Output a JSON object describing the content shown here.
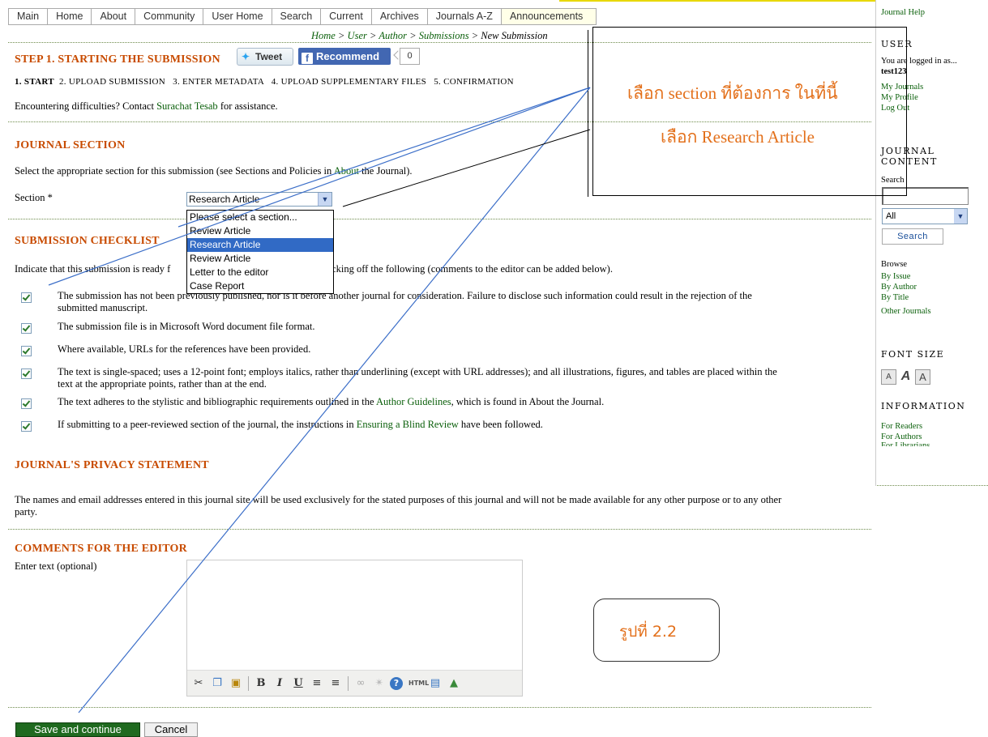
{
  "nav": {
    "items": [
      "Main",
      "Home",
      "About",
      "Community",
      "User Home",
      "Search",
      "Current",
      "Archives",
      "Journals A-Z",
      "Announcements"
    ]
  },
  "breadcrumb": {
    "parts": [
      "Home",
      "User",
      "Author",
      "Submissions",
      "New Submission"
    ],
    "separator": ">"
  },
  "step": {
    "title": "STEP 1. STARTING THE SUBMISSION",
    "tweet_label": "Tweet",
    "recommend_label": "Recommend",
    "recommend_count": "0",
    "steps_current": "1. START",
    "steps_rest": "2. UPLOAD SUBMISSION   3. ENTER METADATA   4. UPLOAD SUPPLEMENTARY FILES   5. CONFIRMATION",
    "difficulty_prefix": "Encountering difficulties? Contact",
    "contact_name": "Surachat Tesab",
    "difficulty_suffix": "for assistance."
  },
  "journal_section": {
    "heading": "JOURNAL SECTION",
    "intro_prefix": "Select the appropriate section for this submission (see Sections and Policies in",
    "intro_link": "About",
    "intro_suffix": "the Journal).",
    "field_label": "Section *",
    "selected": "Research Article",
    "options": [
      "Please select a section...",
      "Review Article",
      "Research Article",
      "Review Article",
      "Letter to the editor",
      "Case Report"
    ]
  },
  "checklist": {
    "heading": "SUBMISSION CHECKLIST",
    "intro_prefix": "Indicate that this submission is ready f",
    "intro_suffix": "y checking off the following (comments to the editor can be added below).",
    "items": [
      {
        "line1": "The submission has not been previously published, nor is it before another journal for consideration. Failure to disclose such information could result in the rejection of the",
        "line2": "submitted manuscript."
      },
      {
        "line1": "The submission file is in Microsoft Word document file format.",
        "line2": ""
      },
      {
        "line1": "Where available, URLs for the references have been provided.",
        "line2": ""
      },
      {
        "line1": "The text is single-spaced; uses a 12-point font; employs italics, rather than underlining (except with URL addresses); and all illustrations, figures, and tables are placed within the",
        "line2": "text at the appropriate points, rather than at the end."
      },
      {
        "line1_prefix": "The text adheres to the stylistic and bibliographic requirements outlined in the",
        "link": "Author Guidelines",
        "line1_suffix": ", which is found in About the Journal."
      },
      {
        "line1_prefix": "If submitting to a peer-reviewed section of the journal, the instructions in",
        "link": "Ensuring a Blind Review",
        "line1_suffix": "have been followed."
      }
    ]
  },
  "privacy": {
    "heading": "JOURNAL'S PRIVACY STATEMENT",
    "line1": "The names and email addresses entered in this journal site will be used exclusively for the stated purposes of this journal and will not be made available for any other purpose or to any other",
    "line2": "party."
  },
  "comments": {
    "heading": "COMMENTS FOR THE EDITOR",
    "label": "Enter text (optional)",
    "toolbar_icons": [
      "cut-icon",
      "copy-icon",
      "paste-icon",
      "bold-icon",
      "italic-icon",
      "underline-icon",
      "bullet-list-icon",
      "numbered-list-icon",
      "link-icon",
      "unlink-icon",
      "help-icon",
      "html-icon",
      "fullscreen-icon",
      "image-icon"
    ]
  },
  "actions": {
    "save": "Save and continue",
    "cancel": "Cancel"
  },
  "sidebar": {
    "journal_help": "Journal Help",
    "user_heading": "USER",
    "logged_in_as": "You are logged in as...",
    "username": "test123",
    "user_links": [
      "My Journals",
      "My Profile",
      "Log Out"
    ],
    "content_heading_1": "JOURNAL",
    "content_heading_2": "CONTENT",
    "search_label": "Search",
    "search_scope": "All",
    "search_button": "Search",
    "browse_label": "Browse",
    "browse_links": [
      "By Issue",
      "By Author",
      "By Title",
      "Other Journals"
    ],
    "font_size_heading": "FONT SIZE",
    "information_heading": "INFORMATION",
    "info_links": [
      "For Readers",
      "For Authors",
      "For Librarians"
    ]
  },
  "annotation": {
    "line1": "เลือก section ที่ต้องการ ในที่นี้",
    "line2": "เลือก Research Article",
    "figure_label": "รูปที่ 2.2"
  },
  "colors": {
    "heading": "#c84b00",
    "link": "#0a5f0a",
    "annotation": "#e3701b",
    "save_button": "#1f6a1f"
  }
}
